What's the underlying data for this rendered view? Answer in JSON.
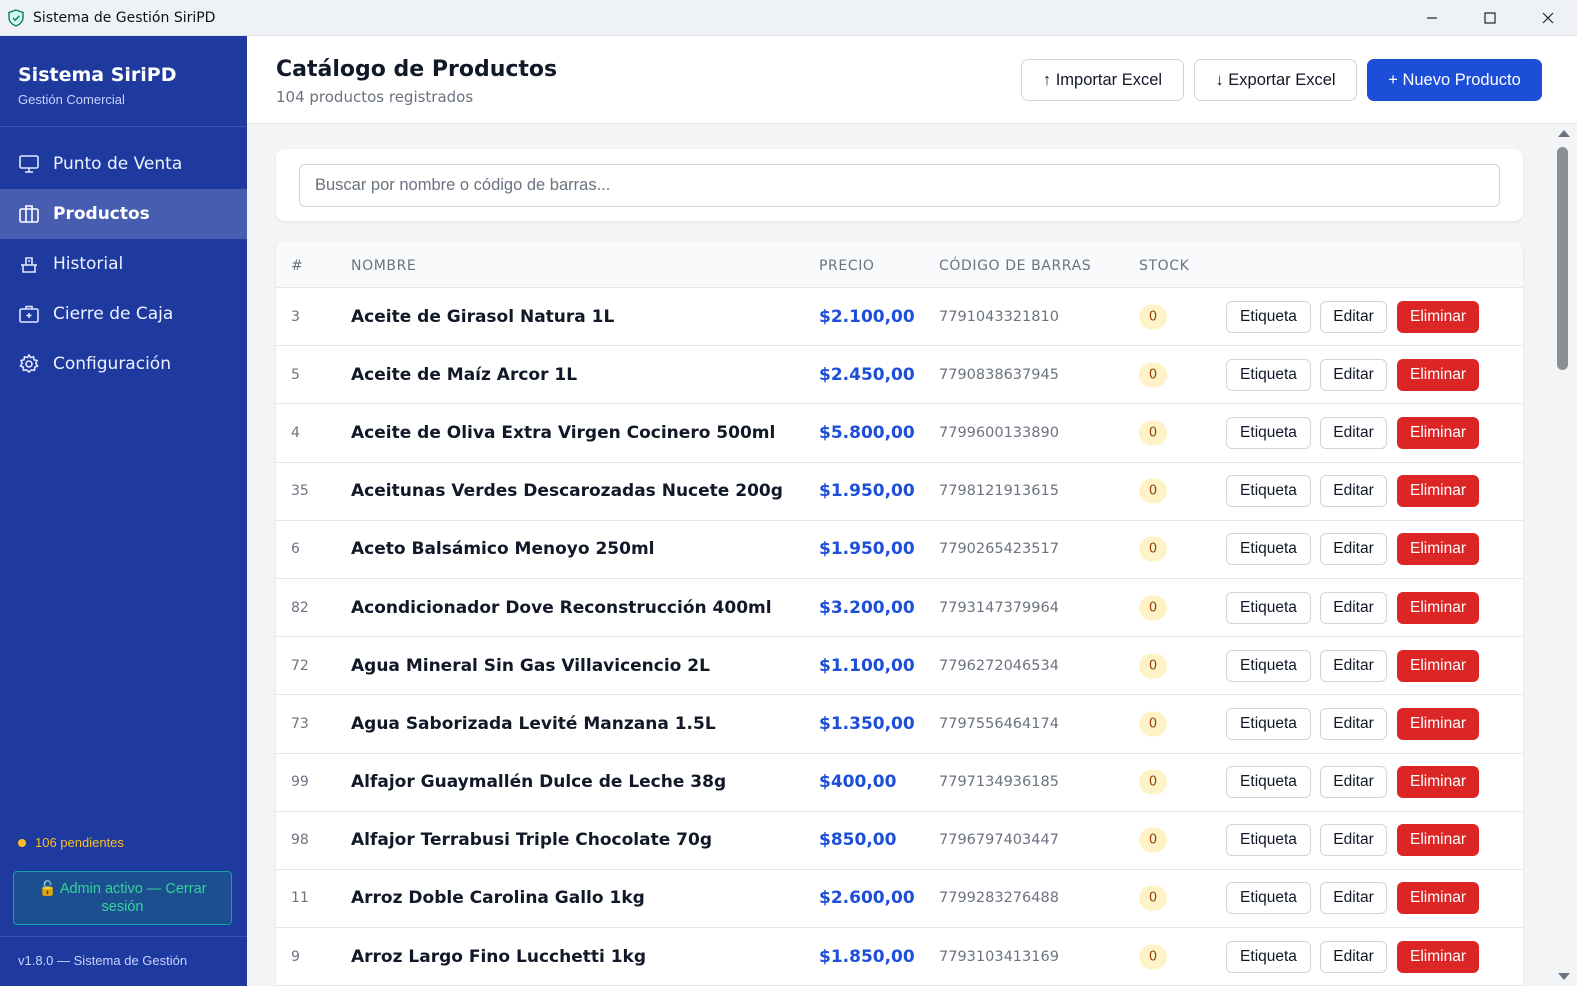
{
  "window": {
    "title": "Sistema de Gestión SiriPD"
  },
  "sidebar": {
    "brand_title": "Sistema SiriPD",
    "brand_subtitle": "Gestión Comercial",
    "items": [
      {
        "label": "Punto de Venta",
        "icon": "monitor-icon",
        "active": false
      },
      {
        "label": "Productos",
        "icon": "package-icon",
        "active": true
      },
      {
        "label": "Historial",
        "icon": "history-icon",
        "active": false
      },
      {
        "label": "Cierre de Caja",
        "icon": "briefcase-icon",
        "active": false
      },
      {
        "label": "Configuración",
        "icon": "gear-icon",
        "active": false
      }
    ],
    "pending": "106 pendientes",
    "admin_button": "🔓 Admin activo — Cerrar sesión",
    "version": "v1.8.0 — Sistema de Gestión"
  },
  "header": {
    "title": "Catálogo de Productos",
    "subtitle": "104 productos registrados",
    "import_label": "↑ Importar Excel",
    "export_label": "↓ Exportar Excel",
    "new_label": "+ Nuevo Producto"
  },
  "search": {
    "placeholder": "Buscar por nombre o código de barras...",
    "value": ""
  },
  "table": {
    "columns": [
      "#",
      "NOMBRE",
      "PRECIO",
      "CÓDIGO DE BARRAS",
      "STOCK"
    ],
    "action_labels": {
      "label": "Etiqueta",
      "edit": "Editar",
      "delete": "Eliminar"
    },
    "rows": [
      {
        "id": "3",
        "name": "Aceite de Girasol Natura 1L",
        "price": "$2.100,00",
        "barcode": "7791043321810",
        "stock": "0"
      },
      {
        "id": "5",
        "name": "Aceite de Maíz Arcor 1L",
        "price": "$2.450,00",
        "barcode": "7790838637945",
        "stock": "0"
      },
      {
        "id": "4",
        "name": "Aceite de Oliva Extra Virgen Cocinero 500ml",
        "price": "$5.800,00",
        "barcode": "7799600133890",
        "stock": "0"
      },
      {
        "id": "35",
        "name": "Aceitunas Verdes Descarozadas Nucete 200g",
        "price": "$1.950,00",
        "barcode": "7798121913615",
        "stock": "0"
      },
      {
        "id": "6",
        "name": "Aceto Balsámico Menoyo 250ml",
        "price": "$1.950,00",
        "barcode": "7790265423517",
        "stock": "0"
      },
      {
        "id": "82",
        "name": "Acondicionador Dove Reconstrucción 400ml",
        "price": "$3.200,00",
        "barcode": "7793147379964",
        "stock": "0"
      },
      {
        "id": "72",
        "name": "Agua Mineral Sin Gas Villavicencio 2L",
        "price": "$1.100,00",
        "barcode": "7796272046534",
        "stock": "0"
      },
      {
        "id": "73",
        "name": "Agua Saborizada Levité Manzana 1.5L",
        "price": "$1.350,00",
        "barcode": "7797556464174",
        "stock": "0"
      },
      {
        "id": "99",
        "name": "Alfajor Guaymallén Dulce de Leche 38g",
        "price": "$400,00",
        "barcode": "7797134936185",
        "stock": "0"
      },
      {
        "id": "98",
        "name": "Alfajor Terrabusi Triple Chocolate 70g",
        "price": "$850,00",
        "barcode": "7796797403447",
        "stock": "0"
      },
      {
        "id": "11",
        "name": "Arroz Doble Carolina Gallo 1kg",
        "price": "$2.600,00",
        "barcode": "7799283276488",
        "stock": "0"
      },
      {
        "id": "9",
        "name": "Arroz Largo Fino Lucchetti 1kg",
        "price": "$1.850,00",
        "barcode": "7793103413169",
        "stock": "0"
      }
    ]
  },
  "colors": {
    "sidebar": "#1e3a9f",
    "primary": "#1d4ed8",
    "danger": "#dc2626",
    "success": "#34d399",
    "warning": "#fbbf24"
  }
}
